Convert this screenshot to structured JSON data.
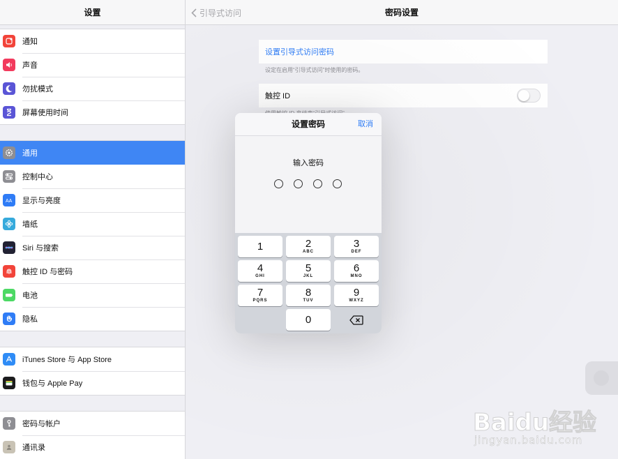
{
  "sidebar": {
    "title": "设置",
    "groups": [
      {
        "items": [
          {
            "label": "通知",
            "icon": "notifications-icon",
            "color": "#f2443a"
          },
          {
            "label": "声音",
            "icon": "sounds-icon",
            "color": "#f23a5d"
          },
          {
            "label": "勿扰模式",
            "icon": "moon-icon",
            "color": "#5a55d6"
          },
          {
            "label": "屏幕使用时间",
            "icon": "hourglass-icon",
            "color": "#5a55d6"
          }
        ]
      },
      {
        "items": [
          {
            "label": "通用",
            "icon": "gear-icon",
            "color": "#8e8e93",
            "selected": true
          },
          {
            "label": "控制中心",
            "icon": "toggles-icon",
            "color": "#8e8e93"
          },
          {
            "label": "显示与亮度",
            "icon": "display-icon",
            "color": "#2f7cf6"
          },
          {
            "label": "墙纸",
            "icon": "wallpaper-icon",
            "color": "#36aadc"
          },
          {
            "label": "Siri 与搜索",
            "icon": "siri-icon",
            "color": "#222233"
          },
          {
            "label": "触控 ID 与密码",
            "icon": "fingerprint-icon",
            "color": "#f2443a"
          },
          {
            "label": "电池",
            "icon": "battery-icon",
            "color": "#4cd964"
          },
          {
            "label": "隐私",
            "icon": "hand-icon",
            "color": "#2f7cf6"
          }
        ]
      },
      {
        "items": [
          {
            "label": "iTunes Store 与 App Store",
            "icon": "app-store-icon",
            "color": "#2f8cf6"
          },
          {
            "label": "钱包与 Apple Pay",
            "icon": "wallet-icon",
            "color": "#1c1c1e"
          }
        ]
      },
      {
        "items": [
          {
            "label": "密码与帐户",
            "icon": "key-icon",
            "color": "#8e8e93"
          },
          {
            "label": "通讯录",
            "icon": "contacts-icon",
            "color": "#c9c3b5"
          }
        ]
      }
    ]
  },
  "main": {
    "back_label": "引导式访问",
    "title": "密码设置",
    "set_passcode_label": "设置引导式访问密码",
    "set_passcode_footnote": "设定在启用“引导式访问”时使用的密码。",
    "touch_id_label": "触控 ID",
    "touch_id_enabled": false,
    "touch_id_footnote": "使用触控 ID 来结束“引导式访问”。"
  },
  "modal": {
    "title": "设置密码",
    "cancel_label": "取消",
    "prompt": "输入密码",
    "digits_entered": 0,
    "digits_total": 4,
    "keys": [
      [
        {
          "num": "1",
          "letters": ""
        },
        {
          "num": "2",
          "letters": "ABC"
        },
        {
          "num": "3",
          "letters": "DEF"
        }
      ],
      [
        {
          "num": "4",
          "letters": "GHI"
        },
        {
          "num": "5",
          "letters": "JKL"
        },
        {
          "num": "6",
          "letters": "MNO"
        }
      ],
      [
        {
          "num": "7",
          "letters": "PQRS"
        },
        {
          "num": "8",
          "letters": "TUV"
        },
        {
          "num": "9",
          "letters": "WXYZ"
        }
      ],
      [
        {
          "num": "",
          "letters": "",
          "empty": true
        },
        {
          "num": "0",
          "letters": ""
        },
        {
          "num": "",
          "letters": "",
          "delete": true
        }
      ]
    ]
  },
  "watermark": {
    "logo": "Baidu经验",
    "url": "jingyan.baidu.com"
  }
}
